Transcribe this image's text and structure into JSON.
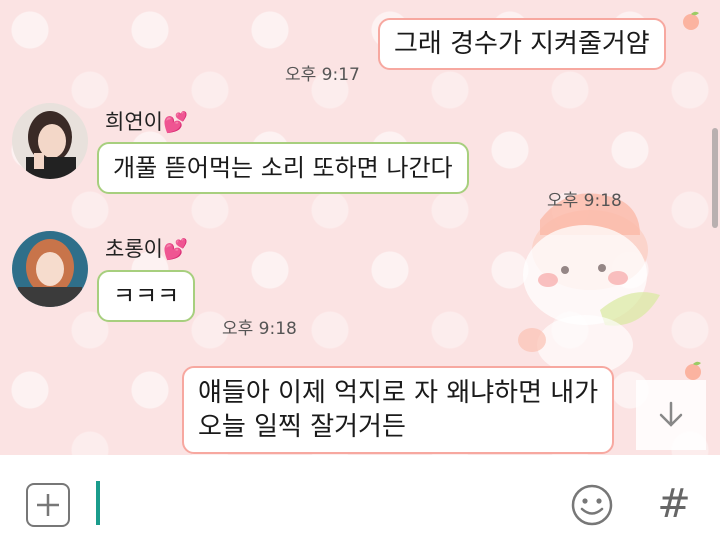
{
  "messages": [
    {
      "type": "outgoing",
      "text": "그래 경수가 지켜줄거얌",
      "time": "오후 9:17"
    },
    {
      "type": "incoming",
      "sender": "희연이",
      "text": "개풀 뜯어먹는 소리 또하면 나간다",
      "time": "오후 9:18"
    },
    {
      "type": "incoming",
      "sender": "초롱이",
      "text": "ㅋㅋㅋ",
      "time": "오후 9:18"
    },
    {
      "type": "outgoing",
      "text_line1": "얘들아 이제 억지로 자 왜냐하면 내가",
      "text_line2": "오늘 일찍 잘거거든"
    }
  ],
  "icons": {
    "heart": "💕",
    "attach": "plus-icon",
    "emoji": "smiley-icon",
    "hash": "#",
    "scroll": "arrow-down-icon"
  },
  "input": {
    "value": "",
    "placeholder": ""
  },
  "colors": {
    "background": "#fbe3e3",
    "outgoing_border": "#f7a8a0",
    "incoming_border": "#a7cf7e",
    "caret": "#1a9c8c"
  }
}
